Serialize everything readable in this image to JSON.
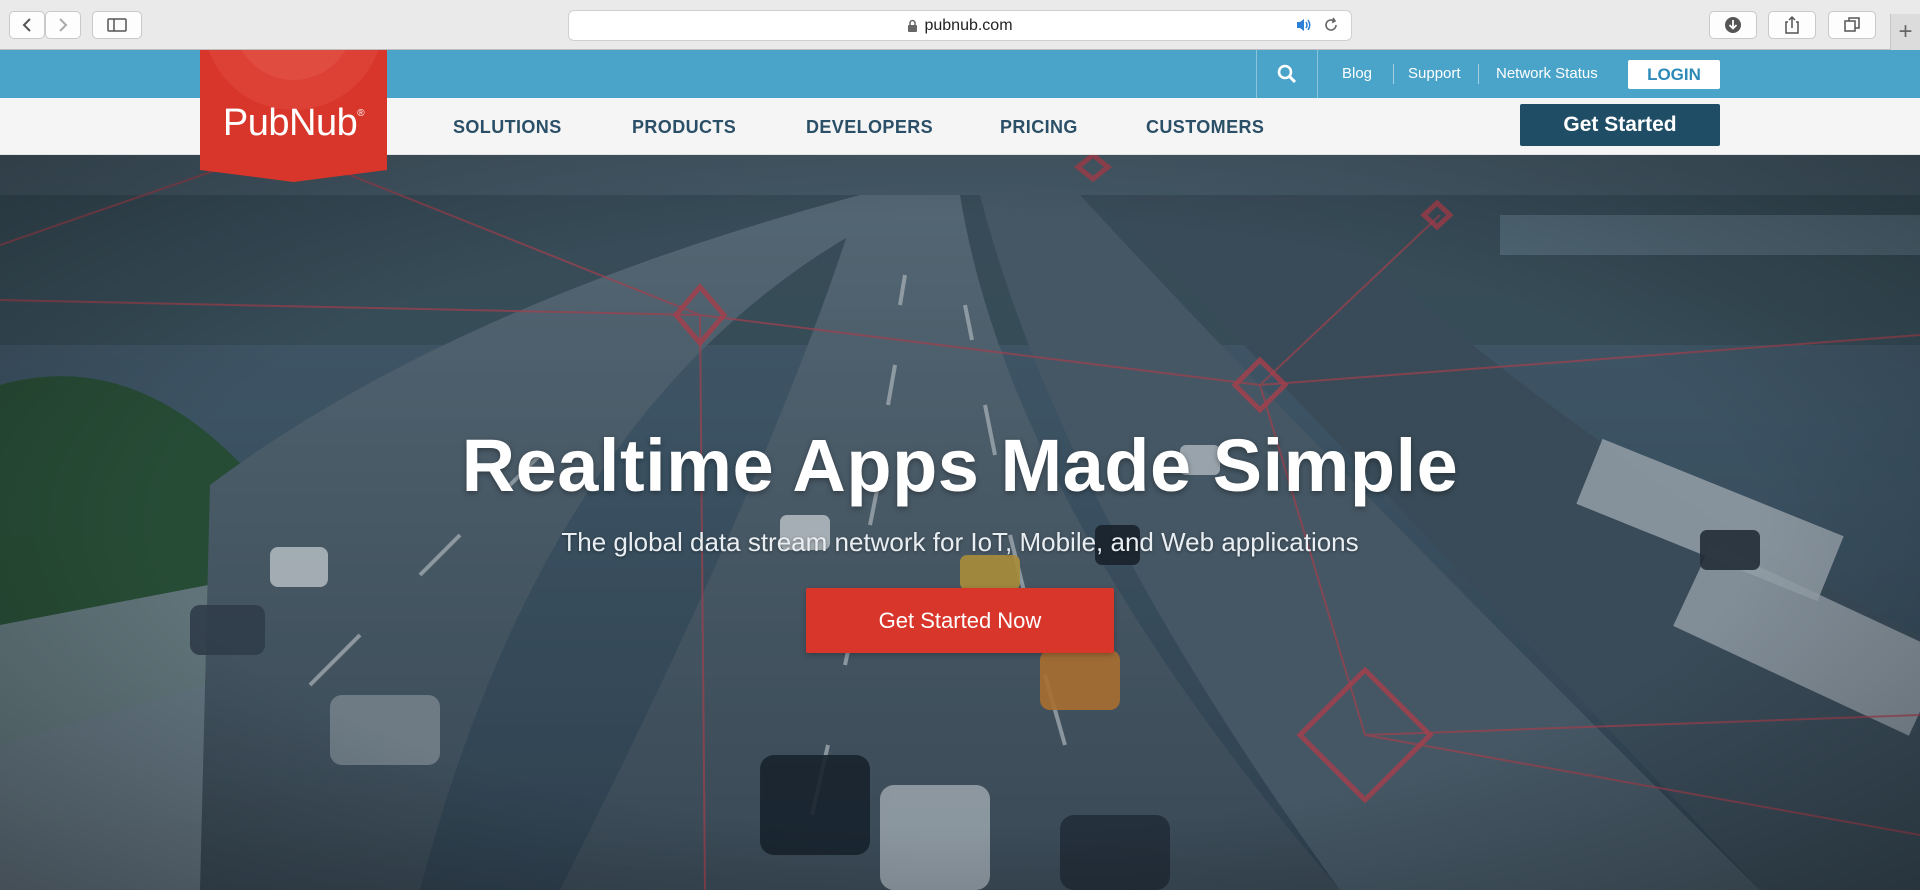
{
  "browser": {
    "url": "pubnub.com",
    "icons": {
      "back": "chevron-left-icon",
      "forward": "chevron-right-icon",
      "sidebar": "sidebar-icon",
      "lock": "lock-icon",
      "audio": "speaker-icon",
      "reload": "reload-icon",
      "downloads": "download-icon",
      "share": "share-icon",
      "tabs": "tabs-overview-icon",
      "new_tab": "plus-icon"
    }
  },
  "site": {
    "logo_text": "PubNub",
    "logo_mark": "®",
    "topbar": {
      "links": [
        "Blog",
        "Support",
        "Network Status"
      ],
      "login": "LOGIN"
    },
    "nav": {
      "items": [
        "SOLUTIONS",
        "PRODUCTS",
        "DEVELOPERS",
        "PRICING",
        "CUSTOMERS"
      ],
      "cta": "Get Started"
    },
    "hero": {
      "title": "Realtime Apps Made Simple",
      "subtitle": "The global data stream network for IoT, Mobile, and Web applications",
      "cta": "Get Started Now"
    }
  },
  "colors": {
    "topbar": "#4aa3c9",
    "brand_red": "#d9362b",
    "nav_text": "#2a4f66",
    "nav_cta": "#1f4d66"
  }
}
